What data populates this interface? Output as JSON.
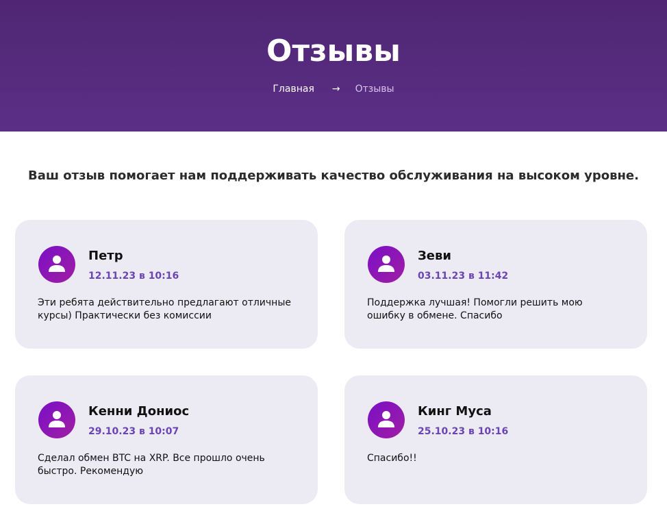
{
  "hero": {
    "title": "Отзывы",
    "breadcrumb": {
      "home": "Главная",
      "separator": "→",
      "current": "Отзывы"
    }
  },
  "intro": "Ваш отзыв помогает нам поддерживать качество обслуживания на высоком уровне.",
  "reviews": [
    {
      "name": "Петр",
      "date": "12.11.23 в 10:16",
      "text": "Эти ребята действительно предлагают отличные курсы) Практически без комиссии"
    },
    {
      "name": "Зеви",
      "date": "03.11.23 в 11:42",
      "text": "Поддержка лучшая! Помогли решить мою ошибку в обмене. Спасибо"
    },
    {
      "name": "Кенни Дониос",
      "date": "29.10.23 в 10:07",
      "text": "Сделал обмен BTC на XRP. Все прошло очень быстро. Рекомендую"
    },
    {
      "name": "Кинг Муса",
      "date": "25.10.23 в 10:16",
      "text": "Спасибо!!"
    }
  ],
  "icons": {
    "avatar": "user-icon"
  },
  "colors": {
    "hero_background": "#532a7c",
    "card_background": "#ecebf3",
    "date_color": "#6a44b3",
    "avatar_gradient_start": "#7a0fc7",
    "avatar_gradient_end": "#a01ea3"
  }
}
